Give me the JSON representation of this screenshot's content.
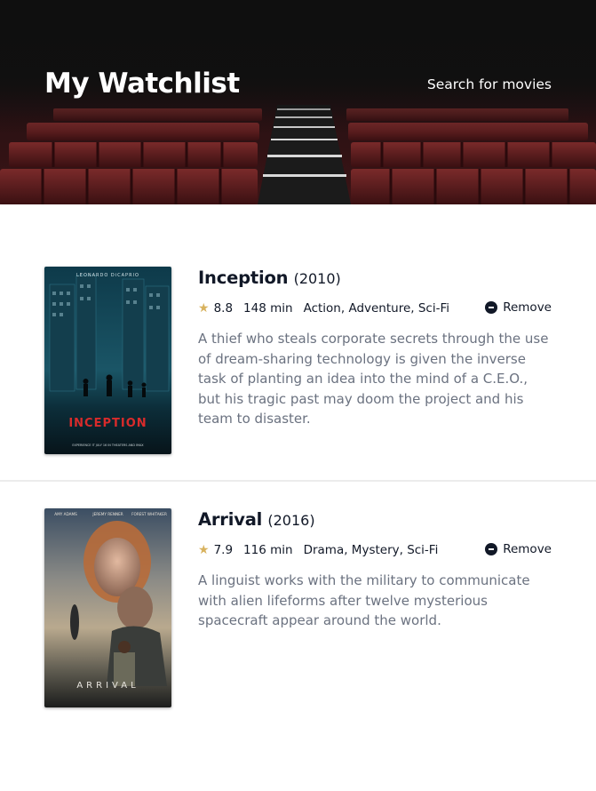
{
  "header": {
    "title": "My Watchlist",
    "search_link": "Search for movies"
  },
  "colors": {
    "star": "#d8b25e",
    "title_text": "#111827",
    "plot_text": "#6b7280",
    "divider": "#ececec"
  },
  "movies": [
    {
      "title": "Inception",
      "year": "(2010)",
      "rating": "8.8",
      "runtime": "148 min",
      "genres": "Action, Adventure, Sci-Fi",
      "remove_label": "Remove",
      "plot": "A thief who steals corporate secrets through the use of dream-sharing technology is given the inverse task of planting an idea into the mind of a C.E.O., but his tragic past may doom the project and his team to disaster.",
      "poster": {
        "top_text": "LEONARDO DiCAPRIO",
        "title_text": "INCEPTION",
        "bottom_text": "EXPERIENCE IT JULY 16 IN THEATERS AND IMAX"
      }
    },
    {
      "title": "Arrival",
      "year": "(2016)",
      "rating": "7.9",
      "runtime": "116 min",
      "genres": "Drama, Mystery, Sci-Fi",
      "remove_label": "Remove",
      "plot": "A linguist works with the military to communicate with alien lifeforms after twelve mysterious spacecraft appear around the world.",
      "poster": {
        "cast": [
          "AMY ADAMS",
          "JEREMY RENNER",
          "FOREST WHITAKER"
        ],
        "title_text": "ARRIVAL"
      }
    }
  ]
}
